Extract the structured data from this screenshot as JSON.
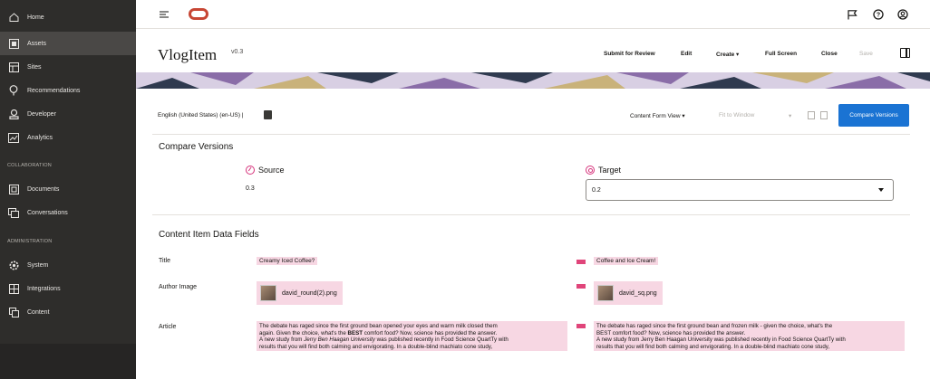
{
  "sidebar": {
    "items": [
      {
        "label": "Home",
        "icon": "home-icon"
      },
      {
        "label": "Assets",
        "icon": "assets-icon",
        "active": true
      },
      {
        "label": "Sites",
        "icon": "sites-icon"
      },
      {
        "label": "Recommendations",
        "icon": "recommendations-icon"
      },
      {
        "label": "Developer",
        "icon": "developer-icon"
      },
      {
        "label": "Analytics",
        "icon": "analytics-icon"
      }
    ],
    "collaboration_label": "COLLABORATION",
    "collab_items": [
      {
        "label": "Documents",
        "icon": "documents-icon"
      },
      {
        "label": "Conversations",
        "icon": "conversations-icon"
      }
    ],
    "administration_label": "ADMINISTRATION",
    "admin_items": [
      {
        "label": "System",
        "icon": "system-icon"
      },
      {
        "label": "Integrations",
        "icon": "integrations-icon"
      },
      {
        "label": "Content",
        "icon": "content-icon"
      }
    ]
  },
  "header": {
    "icons": [
      "hamburger-icon",
      "oracle-logo-icon",
      "flag-icon",
      "help-icon",
      "user-icon"
    ]
  },
  "item": {
    "title": "VlogItem",
    "version": "v0.3",
    "actions": {
      "submit": "Submit for Review",
      "edit": "Edit",
      "create": "Create ▾",
      "full_screen": "Full Screen",
      "close": "Close",
      "save": "Save"
    }
  },
  "toolbar": {
    "language": "English (United States) (en-US) |",
    "content_form_view": "Content Form View ▾",
    "fit_to_window": "Fit to Window",
    "fit_caret": "▾",
    "compare_button": "Compare Versions"
  },
  "compare": {
    "heading": "Compare Versions",
    "source_label": "Source",
    "source_value": "0.3",
    "target_label": "Target",
    "target_value": "0.2"
  },
  "fields": {
    "heading": "Content Item Data Fields",
    "title_label": "Title",
    "title_source": "Creamy Iced Coffee?",
    "title_target": "Coffee and Ice Cream!",
    "author_image_label": "Author Image",
    "author_image_source": "david_round(2).png",
    "author_image_target": "david_sq.png",
    "article_label": "Article",
    "article_source": {
      "l1": "The debate has raged since the first ground bean opened your eyes and warm milk closed them",
      "l2a": "again. Given the choice, what's the ",
      "l2b": "BEST",
      "l2c": " comfort food? Now, science has provided the answer.",
      "l3a": "A new study from ",
      "l3b": "Jerry Ben Haagan University",
      "l3c": " was published recently in Food Science QuartTy with",
      "l4": "results that you will find both calming and envigorating. In a double-blind machiato cone study,"
    },
    "article_target": {
      "l1": "The debate has raged since the first ground bean and frozen milk - given the choice, what's the",
      "l2": "BEST comfort food? Now, science has provided the answer.",
      "l3": "A new study from Jerry Ben Haagan University was published recently in Food Science QuartTy with",
      "l4": "results that you will find both calming and envigorating. In a double-blind machiato cone study,"
    }
  }
}
